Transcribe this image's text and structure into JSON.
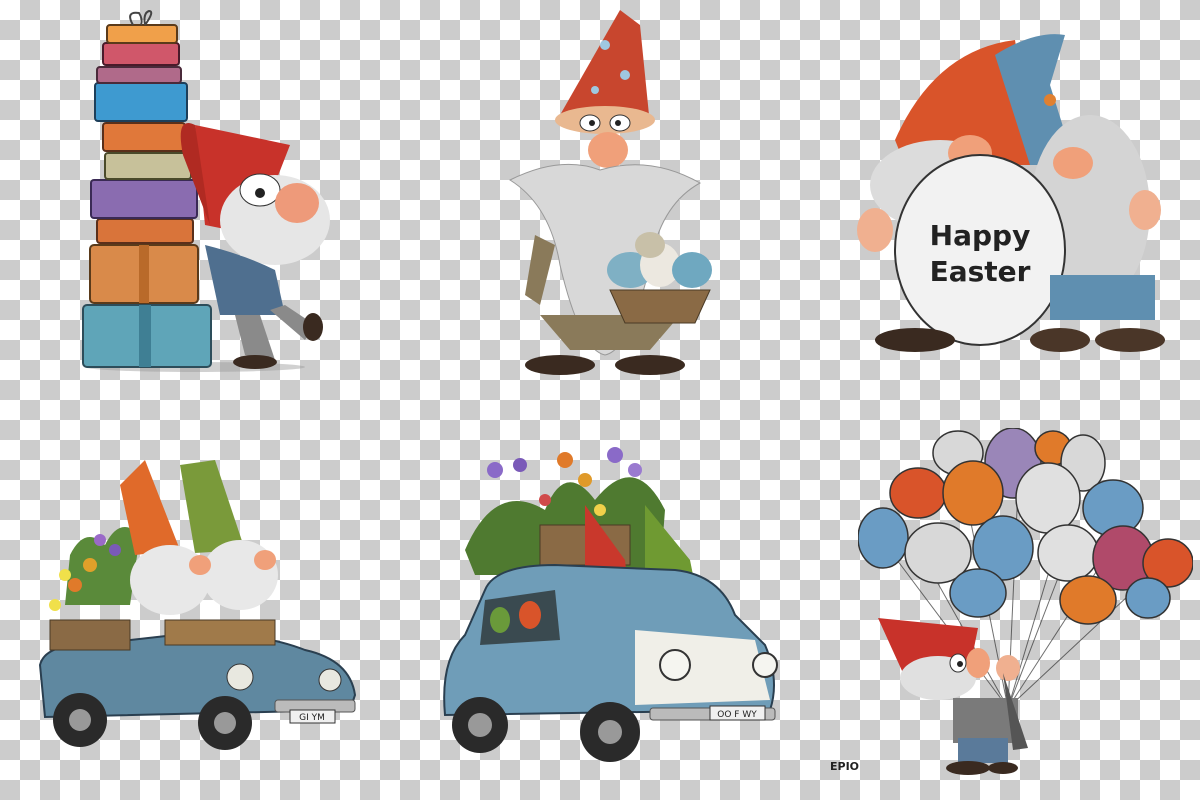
{
  "gnomes": [
    {
      "name": "gnome-with-gift-stack",
      "hat": "#c8322a",
      "shirt": "#4f6f8f"
    },
    {
      "name": "gnome-with-egg-basket",
      "hat": "#c8462e",
      "shirt": "#8a7a5a"
    },
    {
      "name": "gnome-pair-hugging-egg",
      "hat_left": "#d9542a",
      "hat_right": "#5f8fb0"
    },
    {
      "name": "gnome-pair-in-convertible",
      "hat_left": "#e06a2a",
      "hat_right": "#7a9a3a",
      "car": "#5f88a0"
    },
    {
      "name": "gnome-pair-on-car-with-flowers",
      "hat_left": "#c9382c",
      "hat_right": "#6f9a32",
      "car": "#6f9db8"
    },
    {
      "name": "gnome-with-egg-balloons",
      "hat": "#c8322a"
    }
  ],
  "egg_text": {
    "line1": "Happy",
    "line2": "Easter"
  },
  "plates": {
    "left_car": "GI YM",
    "right_car": "OO F WY"
  },
  "signature": "EPIO"
}
